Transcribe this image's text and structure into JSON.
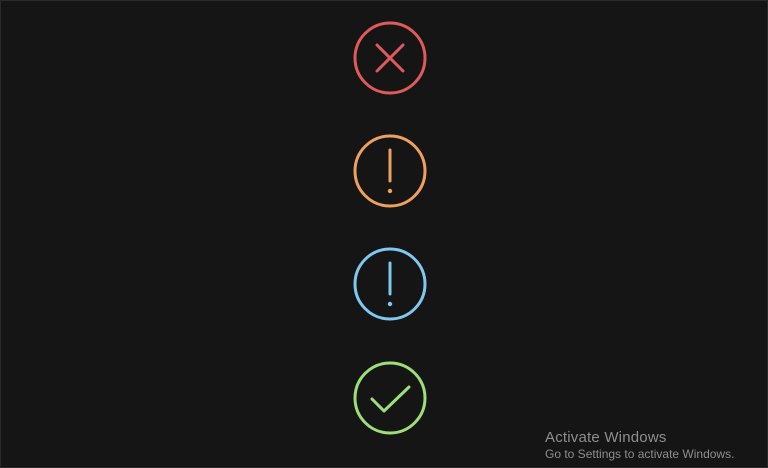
{
  "status_icons": [
    {
      "name": "error-icon",
      "symbol": "x-circle",
      "color": "#e05a5a"
    },
    {
      "name": "warning-icon",
      "symbol": "exclamation-circle",
      "color": "#eea05e"
    },
    {
      "name": "info-icon",
      "symbol": "exclamation-circle",
      "color": "#7fc8ef"
    },
    {
      "name": "success-icon",
      "symbol": "check-circle",
      "color": "#9dde79"
    }
  ],
  "watermark": {
    "title": "Activate Windows",
    "subtitle": "Go to Settings to activate Windows."
  }
}
